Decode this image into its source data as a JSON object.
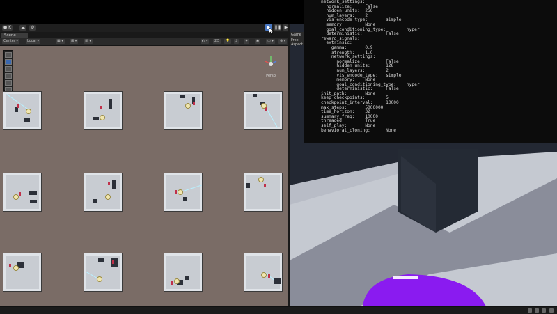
{
  "window": {
    "scene_tab": "Scene",
    "game_tab": "Game",
    "game_aspect": "Free Aspect"
  },
  "toolbar": {
    "account_label": "K",
    "play_icon": "play-icon",
    "pause_icon": "pause-icon",
    "step_icon": "step-icon"
  },
  "scene_toolbar": {
    "pivot_mode": "Center",
    "pivot_space": "Local",
    "persp_label": "Persp"
  },
  "terminal": {
    "lines": [
      "network_settings:",
      "  normalize:     False",
      "  hidden_units:  256",
      "  num_layers:    2",
      "  vis_encode_type:       simple",
      "  memory:        None",
      "  goal_conditioning_type:        hyper",
      "  deterministic:         False",
      "reward_signals:",
      "  extrinsic:",
      "    gamma:       0.9",
      "    strength:    1.0",
      "    network_settings:",
      "      normalize:         False",
      "      hidden_units:      128",
      "      num_layers:        2",
      "      vis_encode_type:   simple",
      "      memory:    None",
      "      goal_conditioning_type:    hyper",
      "      deterministic:     False",
      "init_path:       None",
      "keep_checkpoints:        5",
      "checkpoint_interval:     10000",
      "max_steps:       5000000",
      "time_horizon:    32",
      "summary_freq:    10000",
      "threaded:        True",
      "self_play:       None",
      "behavioral_cloning:      None"
    ]
  },
  "colors": {
    "scene_bg": "#7a6c66",
    "terminal_bg": "#0c0c0c",
    "agent_purple": "#8a1bf0",
    "accent_blue": "#4a78c2"
  }
}
